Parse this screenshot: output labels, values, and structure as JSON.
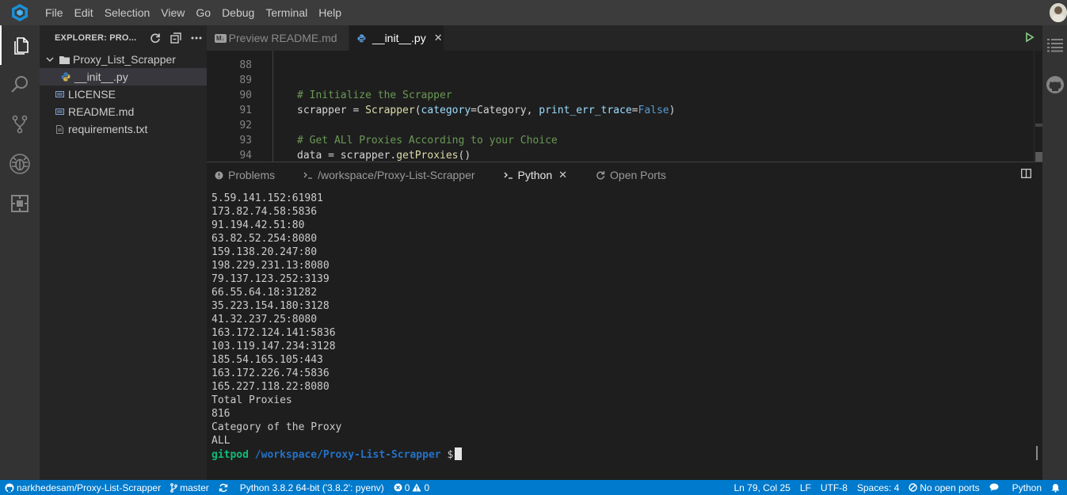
{
  "menu": [
    "File",
    "Edit",
    "Selection",
    "View",
    "Go",
    "Debug",
    "Terminal",
    "Help"
  ],
  "explorer": {
    "title": "EXPLORER: PRO...",
    "folder": "Proxy_List_Scrapper",
    "files": [
      {
        "name": "__init__.py",
        "icon": "python-file-icon",
        "nested": true,
        "selected": true
      },
      {
        "name": "LICENSE",
        "icon": "license-file-icon",
        "nested": false,
        "selected": false
      },
      {
        "name": "README.md",
        "icon": "markdown-file-icon",
        "nested": false,
        "selected": false
      },
      {
        "name": "requirements.txt",
        "icon": "text-file-icon",
        "nested": false,
        "selected": false
      }
    ]
  },
  "tabs": {
    "preview": {
      "badge": "M↓",
      "label": "Preview README.md"
    },
    "active": {
      "label": "__init__.py"
    }
  },
  "code": {
    "lines": [
      {
        "n": "88",
        "text": ""
      },
      {
        "n": "89",
        "comment": "# Initialize the Scrapper"
      },
      {
        "n": "90",
        "a": "scrapper = ",
        "fn": "Scrapper",
        "b": "(",
        "p1": "category",
        "c": "=Category, ",
        "p2": "print_err_trace",
        "d": "=",
        "kw": "False",
        "e": ")"
      },
      {
        "n": "91",
        "text": ""
      },
      {
        "n": "92",
        "comment": "# Get ALl Proxies According to your Choice"
      },
      {
        "n": "93",
        "a": "data = scrapper.",
        "fn": "getProxies",
        "b": "()"
      },
      {
        "n": "94",
        "text": ""
      }
    ]
  },
  "panel": {
    "tabs": [
      {
        "label": "Problems",
        "icon": "problems-icon",
        "active": false
      },
      {
        "label": "/workspace/Proxy-List-Scrapper",
        "icon": "terminal-icon",
        "active": false
      },
      {
        "label": "Python",
        "icon": "terminal-icon",
        "active": true
      },
      {
        "label": "Open Ports",
        "icon": "ports-icon",
        "active": false
      }
    ],
    "terminal_lines": [
      "5.59.141.152:61981",
      "173.82.74.58:5836",
      "91.194.42.51:80",
      "63.82.52.254:8080",
      "159.138.20.247:80",
      "198.229.231.13:8080",
      "79.137.123.252:3139",
      "66.55.64.18:31282",
      "35.223.154.180:3128",
      "41.32.237.25:8080",
      "163.172.124.141:5836",
      "103.119.147.234:3128",
      "185.54.165.105:443",
      "163.172.226.74:5836",
      "165.227.118.22:8080",
      "Total Proxies",
      "816",
      "Category of the Proxy",
      "ALL"
    ],
    "prompt": {
      "user": "gitpod",
      "path": "/workspace/Proxy-List-Scrapper",
      "symbol": "$"
    }
  },
  "status": {
    "repo": "narkhedesam/Proxy-List-Scrapper",
    "branch": "master",
    "interpreter": "Python 3.8.2 64-bit ('3.8.2': pyenv)",
    "errors": "0",
    "warnings": "0",
    "position": "Ln 79, Col 25",
    "eol": "LF",
    "encoding": "UTF-8",
    "spaces": "Spaces: 4",
    "ports": "No open ports",
    "language": "Python"
  },
  "colors": {
    "accent": "#007acc",
    "activity_bar": "#333333",
    "sidebar": "#252526",
    "editor": "#1e1e1e",
    "comment": "#6a9955",
    "prompt_user": "#0dbc79",
    "prompt_path": "#2472c8"
  }
}
